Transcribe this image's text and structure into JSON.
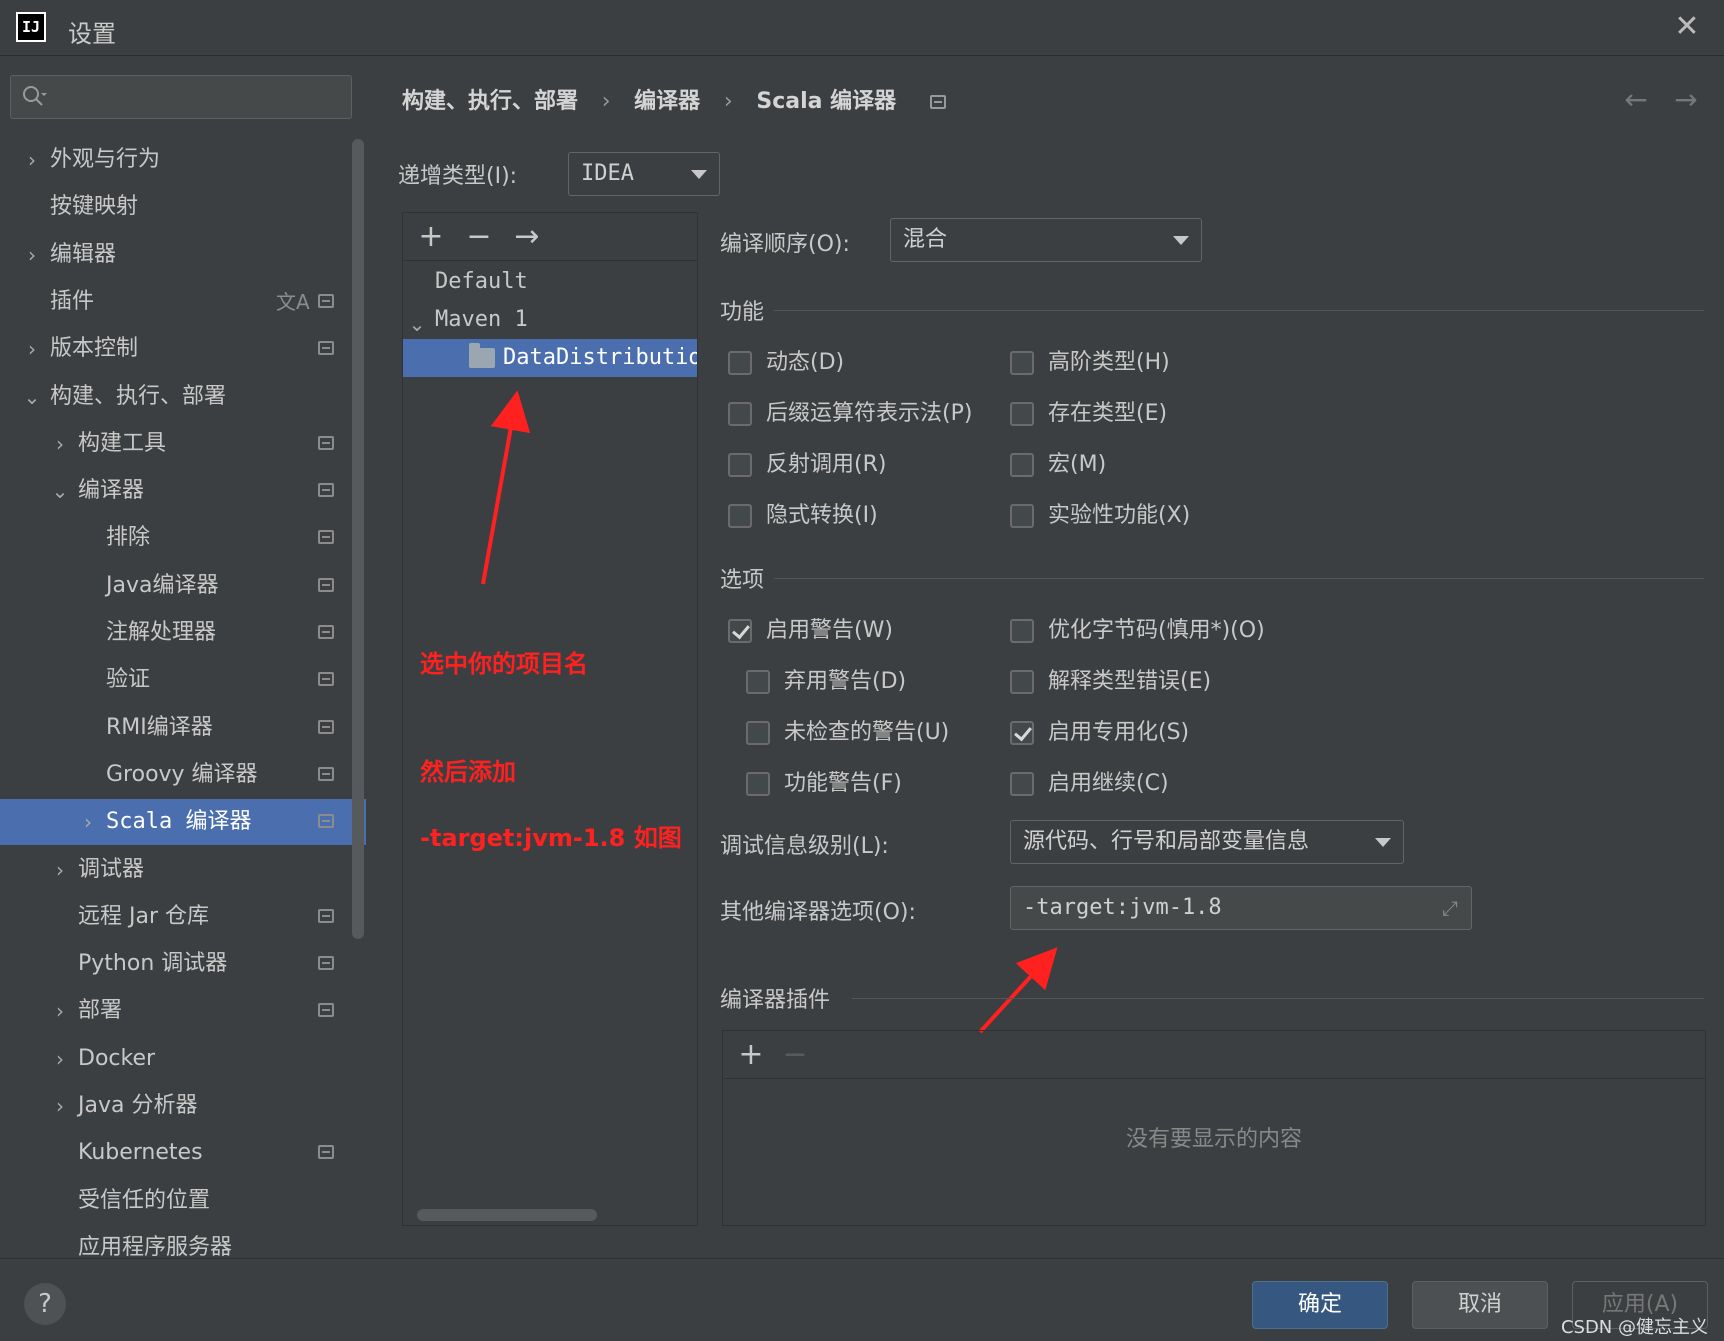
{
  "window": {
    "title": "设置",
    "logo_text": "IJ"
  },
  "search": {
    "placeholder": "",
    "value": ""
  },
  "sidebar": {
    "items": [
      {
        "label": "外观与行为",
        "chevron": "›"
      },
      {
        "label": "按键映射",
        "chevron": ""
      },
      {
        "label": "编辑器",
        "chevron": "›"
      },
      {
        "label": "插件",
        "chevron": ""
      },
      {
        "label": "版本控制",
        "chevron": "›"
      },
      {
        "label": "构建、执行、部署",
        "chevron": "⌄"
      },
      {
        "label": "构建工具",
        "chevron": "›"
      },
      {
        "label": "编译器",
        "chevron": "⌄"
      },
      {
        "label": "排除",
        "chevron": ""
      },
      {
        "label": "Java编译器",
        "chevron": ""
      },
      {
        "label": "注解处理器",
        "chevron": ""
      },
      {
        "label": "验证",
        "chevron": ""
      },
      {
        "label": "RMI编译器",
        "chevron": ""
      },
      {
        "label": "Groovy 编译器",
        "chevron": ""
      },
      {
        "label": "Scala 编译器",
        "chevron": "›"
      },
      {
        "label": "调试器",
        "chevron": "›"
      },
      {
        "label": "远程 Jar 仓库",
        "chevron": ""
      },
      {
        "label": "Python 调试器",
        "chevron": ""
      },
      {
        "label": "部署",
        "chevron": "›"
      },
      {
        "label": "Docker",
        "chevron": "›"
      },
      {
        "label": "Java 分析器",
        "chevron": "›"
      },
      {
        "label": "Kubernetes",
        "chevron": ""
      },
      {
        "label": "受信任的位置",
        "chevron": ""
      },
      {
        "label": "应用程序服务器",
        "chevron": ""
      }
    ],
    "translate_glyph": "文A"
  },
  "breadcrumb": {
    "items": [
      "构建、执行、部署",
      "编译器",
      "Scala 编译器"
    ],
    "separator": "›",
    "back": "←",
    "forward": "→"
  },
  "incremental": {
    "label": "递增类型(I):",
    "value": "IDEA"
  },
  "profiles": {
    "add": "+",
    "remove": "−",
    "move": "→",
    "items": [
      {
        "label": "Default",
        "chevron": ""
      },
      {
        "label": "Maven 1",
        "chevron": "⌄"
      },
      {
        "label": "DataDistributio",
        "chevron": ""
      }
    ]
  },
  "annotations": {
    "select_project": "选中你的项目名",
    "then_add": "然后添加",
    "target_hint": "-target:jvm-1.8 如图"
  },
  "compile_order": {
    "label": "编译顺序(O):",
    "value": "混合"
  },
  "features": {
    "title": "功能",
    "items": [
      {
        "label": "动态(D)",
        "checked": false
      },
      {
        "label": "高阶类型(H)",
        "checked": false
      },
      {
        "label": "后缀运算符表示法(P)",
        "checked": false
      },
      {
        "label": "存在类型(E)",
        "checked": false
      },
      {
        "label": "反射调用(R)",
        "checked": false
      },
      {
        "label": "宏(M)",
        "checked": false
      },
      {
        "label": "隐式转换(I)",
        "checked": false
      },
      {
        "label": "实验性功能(X)",
        "checked": false
      }
    ]
  },
  "options": {
    "title": "选项",
    "items": [
      {
        "label": "启用警告(W)",
        "checked": true
      },
      {
        "label": "优化字节码(慎用*)(O)",
        "checked": false
      },
      {
        "label": "弃用警告(D)",
        "checked": false
      },
      {
        "label": "解释类型错误(E)",
        "checked": false
      },
      {
        "label": "未检查的警告(U)",
        "checked": false
      },
      {
        "label": "启用专用化(S)",
        "checked": true
      },
      {
        "label": "功能警告(F)",
        "checked": false
      },
      {
        "label": "启用继续(C)",
        "checked": false
      }
    ]
  },
  "debug_level": {
    "label": "调试信息级别(L):",
    "value": "源代码、行号和局部变量信息"
  },
  "other_options": {
    "label": "其他编译器选项(O):",
    "value": "-target:jvm-1.8"
  },
  "plugins": {
    "title": "编译器插件",
    "add": "+",
    "remove": "−",
    "empty_text": "没有要显示的内容"
  },
  "footer": {
    "help": "?",
    "ok": "确定",
    "cancel": "取消",
    "apply": "应用(A)",
    "credit": "CSDN @健忘主义"
  },
  "colors": {
    "accent": "#4b6eaf",
    "annotation": "#ff2020",
    "primary_button": "#365880"
  }
}
